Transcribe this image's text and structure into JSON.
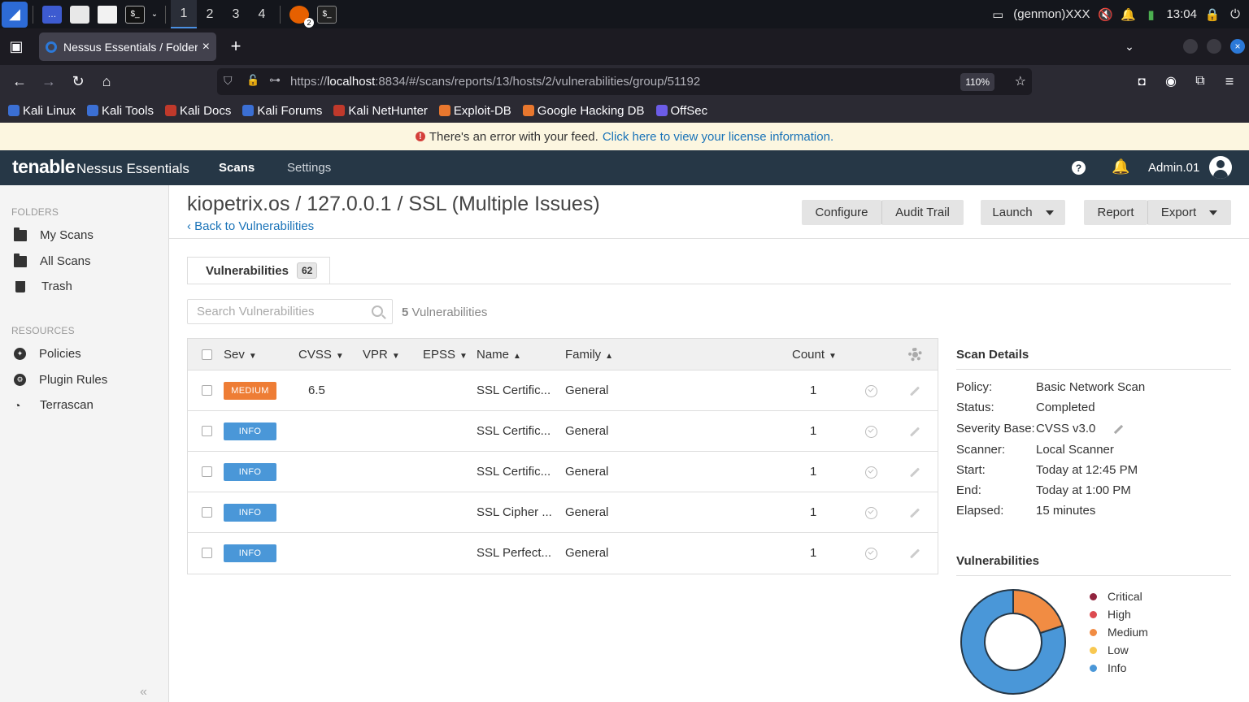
{
  "taskbar": {
    "workspaces": [
      "1",
      "2",
      "3",
      "4"
    ],
    "active_workspace": "1",
    "firefox_badge": "2",
    "genmon": "(genmon)XXX",
    "clock": "13:04"
  },
  "browser": {
    "tab_title": "Nessus Essentials / Folders",
    "url_prefix": "https://",
    "url_host": "localhost",
    "url_rest": ":8834/#/scans/reports/13/hosts/2/vulnerabilities/group/51192",
    "zoom": "110%",
    "bookmarks": [
      "Kali Linux",
      "Kali Tools",
      "Kali Docs",
      "Kali Forums",
      "Kali NetHunter",
      "Exploit-DB",
      "Google Hacking DB",
      "OffSec"
    ],
    "bookmark_colors": [
      "#3b6fd4",
      "#3b6fd4",
      "#c0392b",
      "#3b6fd4",
      "#c0392b",
      "#e8772e",
      "#e8772e",
      "#6c5ce7"
    ]
  },
  "banner": {
    "message": "There's an error with your feed.",
    "link": "Click here to view your license information."
  },
  "header": {
    "logo": "tenable",
    "product": "Nessus Essentials",
    "nav": [
      "Scans",
      "Settings"
    ],
    "user": "Admin.01",
    "help": "?",
    "color": "#263746"
  },
  "sidebar": {
    "folders_heading": "FOLDERS",
    "folders": [
      "My Scans",
      "All Scans",
      "Trash"
    ],
    "resources_heading": "RESOURCES",
    "resources": [
      "Policies",
      "Plugin Rules",
      "Terrascan"
    ],
    "collapse": "«"
  },
  "page": {
    "title": "kiopetrix.os / 127.0.0.1 / SSL (Multiple Issues)",
    "back": "‹ Back to Vulnerabilities",
    "buttons": {
      "configure": "Configure",
      "audit_trail": "Audit Trail",
      "launch": "Launch",
      "report": "Report",
      "export": "Export"
    }
  },
  "vulns": {
    "tab_label": "Vulnerabilities",
    "tab_count": "62",
    "search_placeholder": "Search Vulnerabilities",
    "count_num": "5",
    "count_label": "Vulnerabilities",
    "columns": {
      "sev": "Sev",
      "cvss": "CVSS",
      "vpr": "VPR",
      "epss": "EPSS",
      "name": "Name",
      "family": "Family",
      "count": "Count"
    },
    "rows": [
      {
        "sev": "MEDIUM",
        "sev_color": "#ee7d35",
        "cvss": "6.5",
        "name": "SSL Certific...",
        "family": "General",
        "count": "1"
      },
      {
        "sev": "INFO",
        "sev_color": "#4a97d8",
        "cvss": "",
        "name": "SSL Certific...",
        "family": "General",
        "count": "1"
      },
      {
        "sev": "INFO",
        "sev_color": "#4a97d8",
        "cvss": "",
        "name": "SSL Certific...",
        "family": "General",
        "count": "1"
      },
      {
        "sev": "INFO",
        "sev_color": "#4a97d8",
        "cvss": "",
        "name": "SSL Cipher ...",
        "family": "General",
        "count": "1"
      },
      {
        "sev": "INFO",
        "sev_color": "#4a97d8",
        "cvss": "",
        "name": "SSL Perfect...",
        "family": "General",
        "count": "1"
      }
    ]
  },
  "scan_details": {
    "title": "Scan Details",
    "rows": [
      {
        "label": "Policy:",
        "value": "Basic Network Scan"
      },
      {
        "label": "Status:",
        "value": "Completed"
      },
      {
        "label": "Severity Base:",
        "value": "CVSS v3.0"
      },
      {
        "label": "Scanner:",
        "value": "Local Scanner"
      },
      {
        "label": "Start:",
        "value": "Today at 12:45 PM"
      },
      {
        "label": "End:",
        "value": "Today at 1:00 PM"
      },
      {
        "label": "Elapsed:",
        "value": "15 minutes"
      }
    ]
  },
  "vuln_chart": {
    "title": "Vulnerabilities",
    "legend": [
      {
        "label": "Critical",
        "color": "#91243e"
      },
      {
        "label": "High",
        "color": "#dd4b50"
      },
      {
        "label": "Medium",
        "color": "#f18c43"
      },
      {
        "label": "Low",
        "color": "#f8c851"
      },
      {
        "label": "Info",
        "color": "#4a97d8"
      }
    ]
  },
  "chart_data": {
    "type": "pie",
    "categories": [
      "Critical",
      "High",
      "Medium",
      "Low",
      "Info"
    ],
    "values": [
      0,
      0,
      1,
      0,
      4
    ],
    "colors": [
      "#91243e",
      "#dd4b50",
      "#f18c43",
      "#f8c851",
      "#4a97d8"
    ],
    "title": "Vulnerabilities"
  }
}
